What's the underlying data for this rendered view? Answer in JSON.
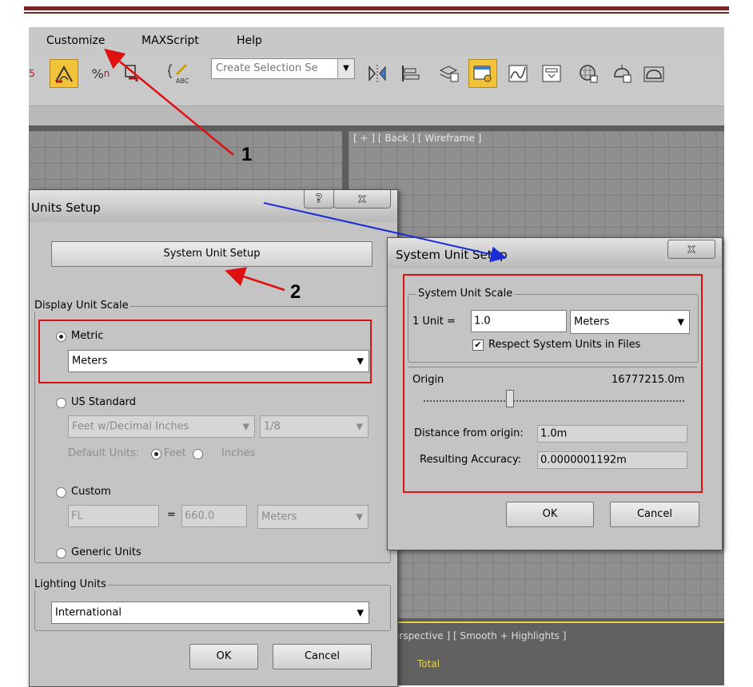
{
  "menu": {
    "customize": "Customize",
    "maxscript": "MAXScript",
    "help": "Help"
  },
  "toolbar": {
    "selection_set": "Create Selection Se",
    "snap_label_1": "5",
    "snap_label_3": "%",
    "edit_label": "ABC"
  },
  "viewport": {
    "back_label": "[ + ] [ Back ] [ Wireframe ]",
    "perspective_label": "erspective ] [ Smooth + Highlights ]",
    "total_label": "Total"
  },
  "units_setup": {
    "title": "Units Setup",
    "help_btn": "?",
    "close_btn": "x",
    "system_unit_setup_btn": "System Unit Setup",
    "display_unit_scale_label": "Display Unit Scale",
    "metric_label": "Metric",
    "metric_value": "Meters",
    "us_standard_label": "US Standard",
    "us_value": "Feet w/Decimal Inches",
    "us_fraction": "1/8",
    "default_units_label": "Default Units:",
    "feet_label": "Feet",
    "inches_label": "Inches",
    "custom_label": "Custom",
    "custom_name": "FL",
    "custom_equals": "=",
    "custom_value": "660.0",
    "custom_unit": "Meters",
    "generic_label": "Generic Units",
    "lighting_units_label": "Lighting Units",
    "lighting_value": "International",
    "ok": "OK",
    "cancel": "Cancel"
  },
  "system_unit_setup": {
    "title": "System Unit Setup",
    "close_btn": "x",
    "scale_label": "System Unit Scale",
    "unit_label": "1 Unit =",
    "unit_value": "1.0",
    "unit_type": "Meters",
    "respect_label": "Respect System Units in Files",
    "respect_checked": true,
    "origin_label": "Origin",
    "origin_value": "16777215.0m",
    "distance_label": "Distance from origin:",
    "distance_value": "1.0m",
    "accuracy_label": "Resulting Accuracy:",
    "accuracy_value": "0.0000001192m",
    "ok": "OK",
    "cancel": "Cancel"
  },
  "annotations": {
    "step1": "1",
    "step2": "2",
    "red": "#e11010",
    "blue": "#1a2bd8"
  }
}
